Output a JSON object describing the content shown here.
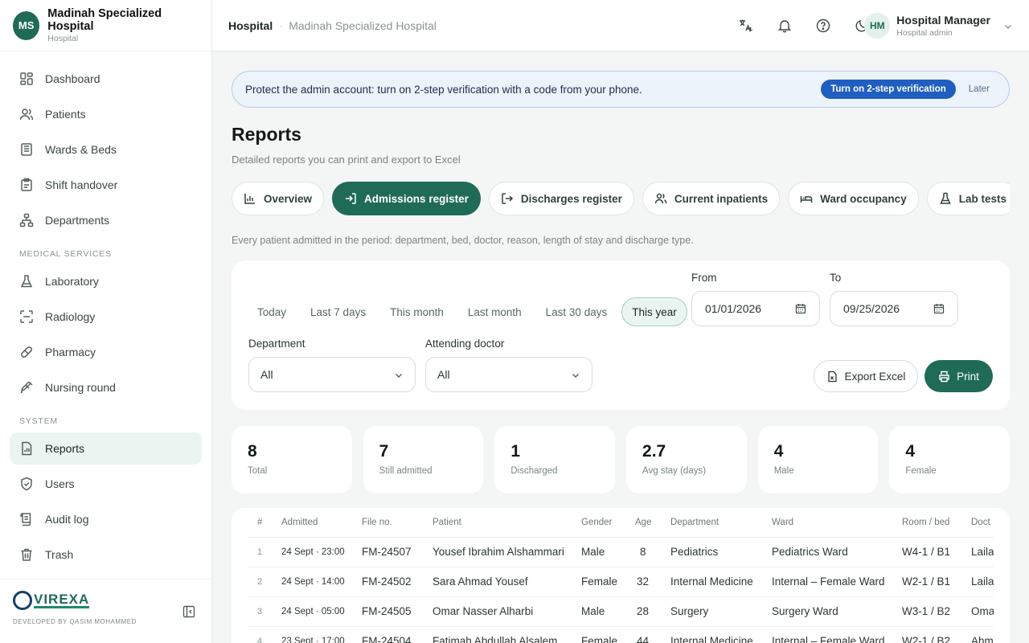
{
  "brand": {
    "initials": "MS",
    "name": "Madinah Specialized Hospital",
    "subtitle": "Hospital"
  },
  "nav": {
    "main": [
      {
        "label": "Dashboard",
        "icon": "dashboard-icon"
      },
      {
        "label": "Patients",
        "icon": "patients-icon"
      },
      {
        "label": "Wards & Beds",
        "icon": "bed-icon"
      },
      {
        "label": "Shift handover",
        "icon": "clipboard-icon"
      },
      {
        "label": "Departments",
        "icon": "hierarchy-icon"
      }
    ],
    "medical_section": "MEDICAL SERVICES",
    "medical": [
      {
        "label": "Laboratory",
        "icon": "flask-icon"
      },
      {
        "label": "Radiology",
        "icon": "scan-icon"
      },
      {
        "label": "Pharmacy",
        "icon": "pill-icon"
      },
      {
        "label": "Nursing round",
        "icon": "syringe-icon"
      }
    ],
    "system_section": "SYSTEM",
    "system": [
      {
        "label": "Reports",
        "icon": "report-icon",
        "active": true
      },
      {
        "label": "Users",
        "icon": "shield-icon"
      },
      {
        "label": "Audit log",
        "icon": "log-icon"
      },
      {
        "label": "Trash",
        "icon": "trash-icon"
      }
    ]
  },
  "footer": {
    "logo": "VIREXA",
    "developer": "DEVELOPED BY QASIM MOHAMMED"
  },
  "topbar": {
    "crumb_main": "Hospital",
    "crumb_sep": "·",
    "crumb_sub": "Madinah Specialized Hospital",
    "user_initials": "HM",
    "user_name": "Hospital Manager",
    "user_role": "Hospital admin"
  },
  "alert": {
    "text": "Protect the admin account: turn on 2-step verification with a code from your phone.",
    "button": "Turn on 2-step verification",
    "later": "Later"
  },
  "page": {
    "title": "Reports",
    "subtitle": "Detailed reports you can print and export to Excel",
    "tabs": [
      "Overview",
      "Admissions register",
      "Discharges register",
      "Current inpatients",
      "Ward occupancy",
      "Lab tests"
    ],
    "active_tab": "Admissions register",
    "tab_description": "Every patient admitted in the period: department, bed, doctor, reason, length of stay and discharge type."
  },
  "filters": {
    "presets": [
      "Today",
      "Last 7 days",
      "This month",
      "Last month",
      "Last 30 days",
      "This year"
    ],
    "active_preset": "This year",
    "from_label": "From",
    "from_value": "01/01/2026",
    "to_label": "To",
    "to_value": "09/25/2026",
    "department_label": "Department",
    "department_value": "All",
    "doctor_label": "Attending doctor",
    "doctor_value": "All",
    "export_label": "Export Excel",
    "print_label": "Print"
  },
  "stats": [
    {
      "value": "8",
      "label": "Total"
    },
    {
      "value": "7",
      "label": "Still admitted"
    },
    {
      "value": "1",
      "label": "Discharged"
    },
    {
      "value": "2.7",
      "label": "Avg stay (days)"
    },
    {
      "value": "4",
      "label": "Male"
    },
    {
      "value": "4",
      "label": "Female"
    }
  ],
  "table": {
    "headers": [
      "#",
      "Admitted",
      "File no.",
      "Patient",
      "Gender",
      "Age",
      "Department",
      "Ward",
      "Room / bed",
      "Doct"
    ],
    "rows": [
      [
        "1",
        "24 Sept · 23:00",
        "FM-24507",
        "Yousef Ibrahim Alshammari",
        "Male",
        "8",
        "Pediatrics",
        "Pediatrics Ward",
        "W4-1 / B1",
        "Laila"
      ],
      [
        "2",
        "24 Sept · 14:00",
        "FM-24502",
        "Sara Ahmad Yousef",
        "Female",
        "32",
        "Internal Medicine",
        "Internal – Female Ward",
        "W2-1 / B1",
        "Laila"
      ],
      [
        "3",
        "24 Sept · 05:00",
        "FM-24505",
        "Omar Nasser Alharbi",
        "Male",
        "28",
        "Surgery",
        "Surgery Ward",
        "W3-1 / B2",
        "Omar"
      ],
      [
        "4",
        "23 Sept · 17:00",
        "FM-24504",
        "Fatimah Abdullah Alsalem",
        "Female",
        "44",
        "Internal Medicine",
        "Internal – Female Ward",
        "W2-1 / B2",
        "Ahm"
      ]
    ]
  }
}
